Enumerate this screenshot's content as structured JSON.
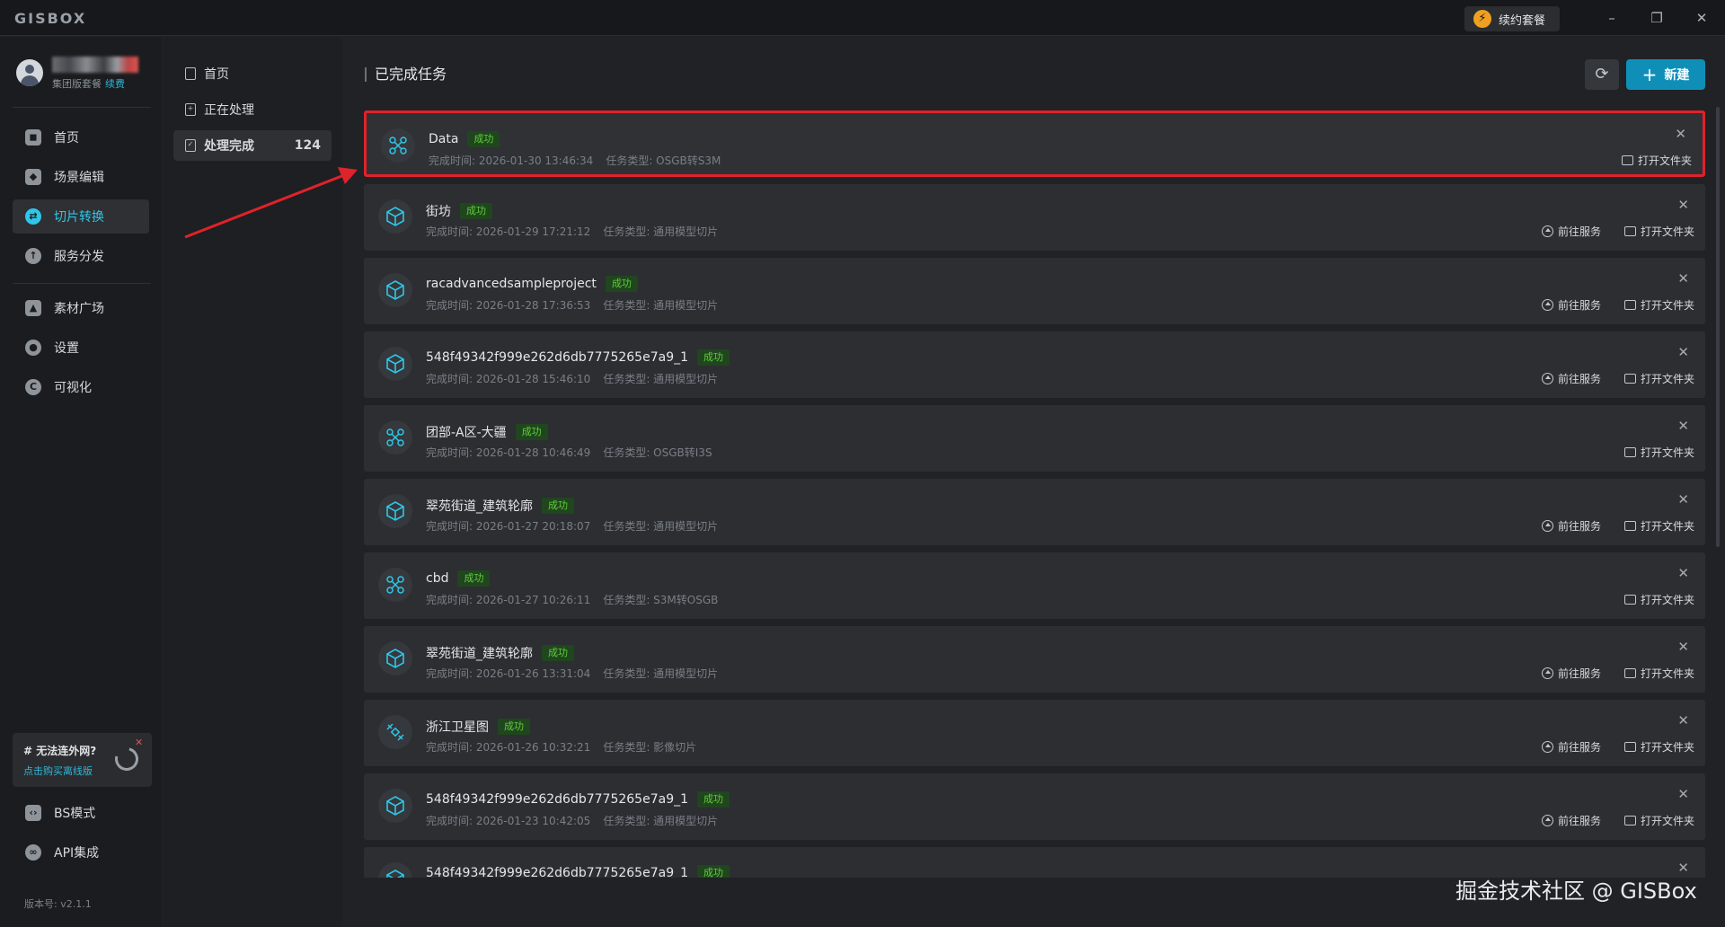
{
  "app": {
    "logo": "GISBOX",
    "renew_label": "续约套餐",
    "minimize": "–",
    "restore": "❐",
    "close": "✕"
  },
  "user": {
    "plan": "集团版套餐",
    "renew": "续费"
  },
  "sidebar": {
    "items": [
      {
        "label": "首页",
        "icon": "home-icon"
      },
      {
        "label": "场景编辑",
        "icon": "cube-icon"
      },
      {
        "label": "切片转换",
        "icon": "convert-icon"
      },
      {
        "label": "服务分发",
        "icon": "upload-icon"
      },
      {
        "label": "素材广场",
        "icon": "image-icon"
      },
      {
        "label": "设置",
        "icon": "gear-icon"
      },
      {
        "label": "可视化",
        "icon": "chart-icon"
      }
    ],
    "bottom_items": [
      {
        "label": "BS模式",
        "icon": "code-icon"
      },
      {
        "label": "API集成",
        "icon": "api-icon"
      }
    ],
    "promo_title": "# 无法连外网?",
    "promo_link": "点击购买离线版",
    "version": "版本号: v2.1.1"
  },
  "subnav": {
    "items": [
      {
        "label": "首页"
      },
      {
        "label": "正在处理"
      },
      {
        "label": "处理完成",
        "count": "124"
      }
    ]
  },
  "main": {
    "title": "已完成任务",
    "new_label": "新建",
    "tasks": [
      {
        "name": "Data",
        "status": "成功",
        "time": "完成时间: 2026-01-30 13:46:34",
        "type": "任务类型: OSGB转S3M",
        "icon": "drone-icon",
        "go_service": "",
        "open_folder": "打开文件夹"
      },
      {
        "name": "街坊",
        "status": "成功",
        "time": "完成时间: 2026-01-29 17:21:12",
        "type": "任务类型: 通用模型切片",
        "icon": "box-icon",
        "go_service": "前往服务",
        "open_folder": "打开文件夹"
      },
      {
        "name": "racadvancedsampleproject",
        "status": "成功",
        "time": "完成时间: 2026-01-28 17:36:53",
        "type": "任务类型: 通用模型切片",
        "icon": "box-icon",
        "go_service": "前往服务",
        "open_folder": "打开文件夹"
      },
      {
        "name": "548f49342f999e262d6db7775265e7a9_1",
        "status": "成功",
        "time": "完成时间: 2026-01-28 15:46:10",
        "type": "任务类型: 通用模型切片",
        "icon": "box-icon",
        "go_service": "前往服务",
        "open_folder": "打开文件夹"
      },
      {
        "name": "团部-A区-大疆",
        "status": "成功",
        "time": "完成时间: 2026-01-28 10:46:49",
        "type": "任务类型: OSGB转I3S",
        "icon": "drone-icon",
        "go_service": "",
        "open_folder": "打开文件夹"
      },
      {
        "name": "翠苑街道_建筑轮廓",
        "status": "成功",
        "time": "完成时间: 2026-01-27 20:18:07",
        "type": "任务类型: 通用模型切片",
        "icon": "box-icon",
        "go_service": "前往服务",
        "open_folder": "打开文件夹"
      },
      {
        "name": "cbd",
        "status": "成功",
        "time": "完成时间: 2026-01-27 10:26:11",
        "type": "任务类型: S3M转OSGB",
        "icon": "drone-icon",
        "go_service": "",
        "open_folder": "打开文件夹"
      },
      {
        "name": "翠苑街道_建筑轮廓",
        "status": "成功",
        "time": "完成时间: 2026-01-26 13:31:04",
        "type": "任务类型: 通用模型切片",
        "icon": "box-icon",
        "go_service": "前往服务",
        "open_folder": "打开文件夹"
      },
      {
        "name": "浙江卫星图",
        "status": "成功",
        "time": "完成时间: 2026-01-26 10:32:21",
        "type": "任务类型: 影像切片",
        "icon": "satellite-icon",
        "go_service": "前往服务",
        "open_folder": "打开文件夹"
      },
      {
        "name": "548f49342f999e262d6db7775265e7a9_1",
        "status": "成功",
        "time": "完成时间: 2026-01-23 10:42:05",
        "type": "任务类型: 通用模型切片",
        "icon": "box-icon",
        "go_service": "前往服务",
        "open_folder": "打开文件夹"
      },
      {
        "name": "548f49342f999e262d6db7775265e7a9_1",
        "status": "成功",
        "time": "",
        "type": "",
        "icon": "box-icon",
        "go_service": "",
        "open_folder": ""
      }
    ]
  },
  "watermark": "掘金技术社区 @ GISBox",
  "colors": {
    "accent": "#2fc6e8",
    "primary_button": "#0f8fb8",
    "success": "#5fcc3a",
    "highlight": "#e0222a"
  }
}
